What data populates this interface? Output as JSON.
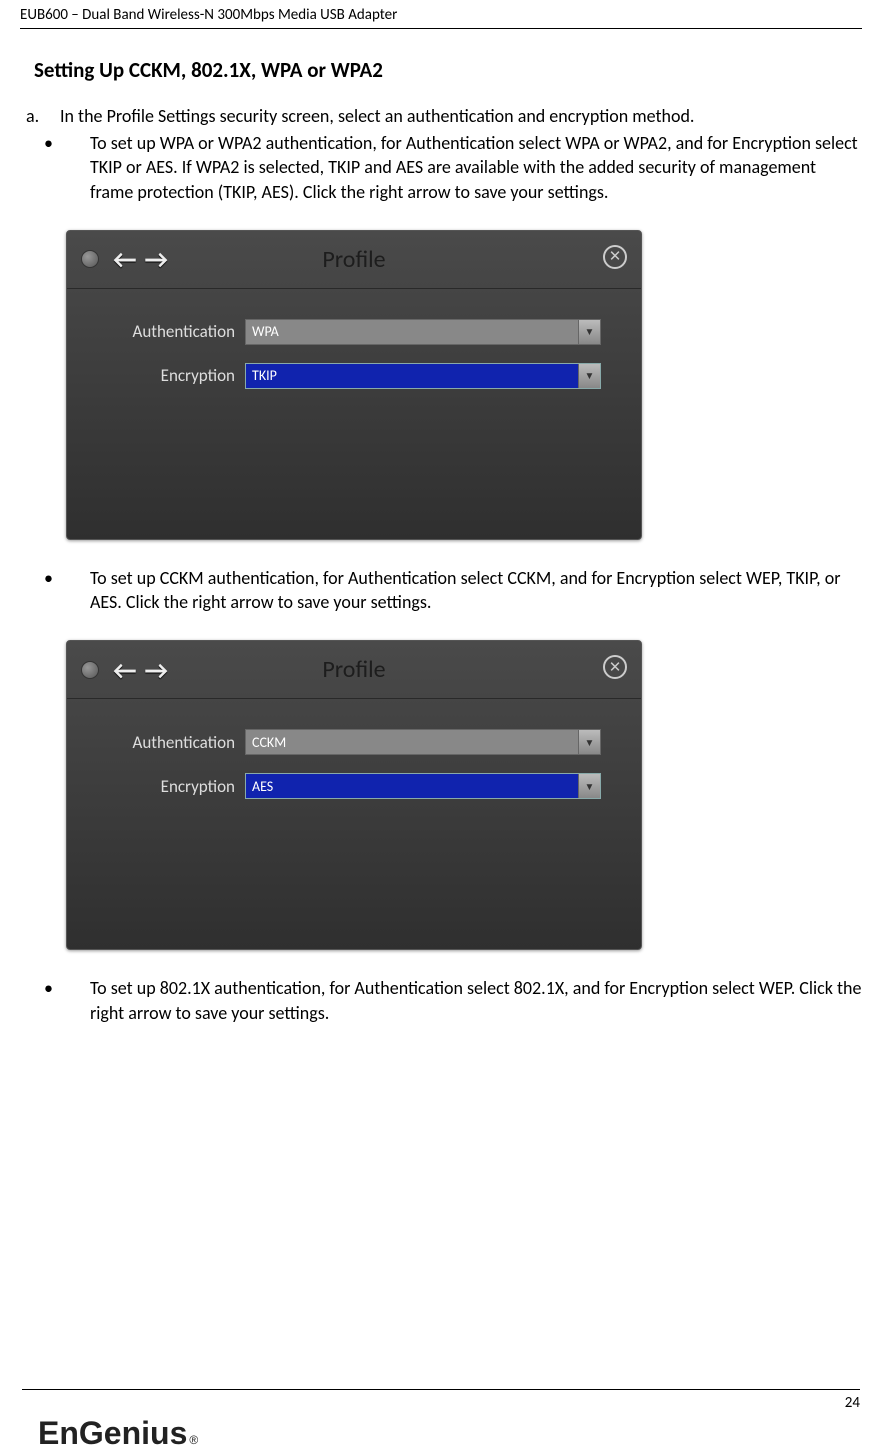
{
  "header": "EUB600 – Dual Band Wireless-N 300Mbps Media USB Adapter",
  "section_title": "Setting Up CCKM, 802.1X, WPA or WPA2",
  "item_a": {
    "marker": "a.",
    "text": "In the Profile Settings security screen, select an authentication and encryption method."
  },
  "bullets": [
    "To set up WPA or WPA2 authentication, for Authentication select WPA or WPA2, and for Encryption select TKIP or AES. If WPA2 is selected, TKIP and AES are available with the added security of management frame protection (TKIP, AES). Click the right arrow to save your settings.",
    "To set up CCKM authentication, for Authentication select CCKM, and for Encryption select WEP, TKIP, or AES. Click the right arrow to save your settings.",
    "To set up 802.1X authentication, for Authentication select 802.1X, and for Encryption select WEP. Click the right arrow to save your settings."
  ],
  "screenshot1": {
    "title": "Profile",
    "auth_label": "Authentication",
    "enc_label": "Encryption",
    "auth_value": "WPA",
    "enc_value": "TKIP"
  },
  "screenshot2": {
    "title": "Profile",
    "auth_label": "Authentication",
    "enc_label": "Encryption",
    "auth_value": "CCKM",
    "enc_value": "AES"
  },
  "page_number": "24",
  "logo": {
    "part1": "En",
    "part2": "Genius",
    "reg": "®"
  },
  "glyphs": {
    "back": "←",
    "forward": "→",
    "close": "✕",
    "down": "▼"
  }
}
